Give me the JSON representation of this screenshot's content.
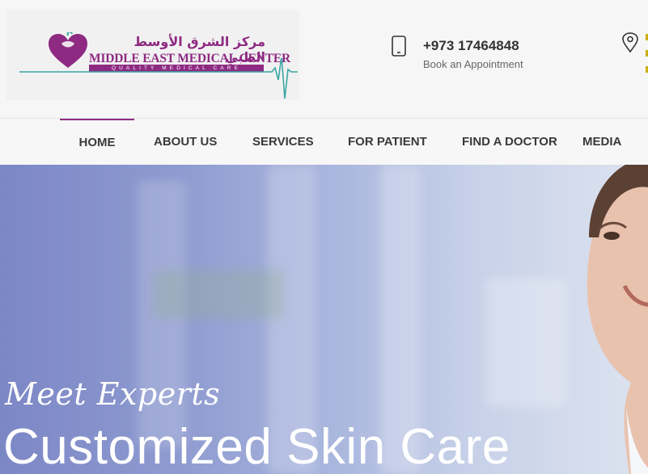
{
  "logo": {
    "arabic": "مركز الشرق الأوسط الطبي",
    "name": "MIDDLE EAST MEDICAL CENTER",
    "tagline": "QUALITY MEDICAL CARE",
    "brand_color": "#8e2a82",
    "accent_color": "#3aa6a3"
  },
  "contact": {
    "phone": "+973 17464848",
    "phone_caption": "Book an Appointment",
    "phone_icon": "mobile-phone-icon",
    "location_icon": "map-pin-icon"
  },
  "nav": {
    "items": [
      {
        "label": "HOME",
        "active": true
      },
      {
        "label": "ABOUT US"
      },
      {
        "label": "SERVICES"
      },
      {
        "label": "FOR PATIENT"
      },
      {
        "label": "FIND A DOCTOR"
      },
      {
        "label": "MEDIA"
      }
    ],
    "active_color": "#8e2a82"
  },
  "hero": {
    "subtitle": "Meet Experts",
    "title": "Customized Skin Care"
  }
}
